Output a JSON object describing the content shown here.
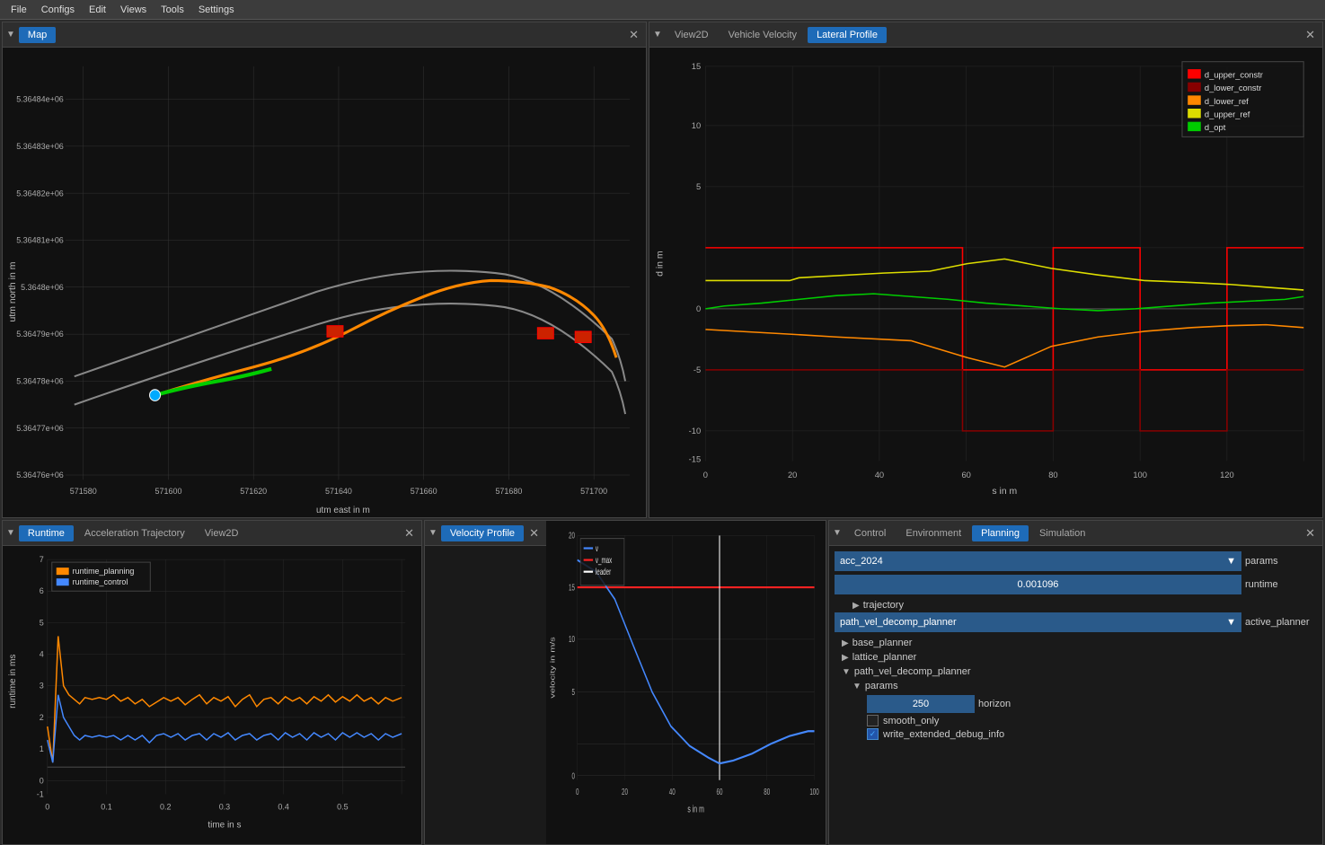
{
  "menubar": {
    "items": [
      "File",
      "Configs",
      "Edit",
      "Views",
      "Tools",
      "Settings"
    ]
  },
  "map_panel": {
    "title": "Map",
    "close_label": "✕",
    "x_axis_label": "utm east in m",
    "y_axis_label": "utm north in m",
    "x_ticks": [
      "571580",
      "571600",
      "571620",
      "571640",
      "571660",
      "571680",
      "571700"
    ],
    "y_ticks": [
      "5.36476e+06",
      "5.36477e+06",
      "5.36478e+06",
      "5.36479e+06",
      "5.3648e+06",
      "5.36481e+06",
      "5.36482e+06",
      "5.36483e+06",
      "5.36484e+06"
    ]
  },
  "lateral_panel": {
    "tabs": [
      "View2D",
      "Vehicle Velocity",
      "Lateral Profile"
    ],
    "active_tab": "Lateral Profile",
    "close_label": "✕",
    "legend": [
      {
        "label": "d_upper_constr",
        "color": "#ff0000"
      },
      {
        "label": "d_lower_constr",
        "color": "#cc0000"
      },
      {
        "label": "d_lower_ref",
        "color": "#ff8800"
      },
      {
        "label": "d_upper_ref",
        "color": "#dddd00"
      },
      {
        "label": "d_opt",
        "color": "#00ff00"
      }
    ],
    "x_axis_label": "s in m",
    "y_axis_label": "d in m",
    "x_ticks": [
      "0",
      "20",
      "40",
      "60",
      "80",
      "100",
      "120"
    ],
    "y_ticks": [
      "-15",
      "-10",
      "-5",
      "0",
      "5",
      "10",
      "15"
    ]
  },
  "runtime_panel": {
    "tabs": [
      "Runtime",
      "Acceleration Trajectory",
      "View2D"
    ],
    "active_tab": "Runtime",
    "close_label": "✕",
    "legend": [
      {
        "label": "runtime_planning",
        "color": "#ff8800"
      },
      {
        "label": "runtime_control",
        "color": "#4488ff"
      }
    ],
    "x_axis_label": "time in s",
    "y_axis_label": "runtime in ms",
    "x_ticks": [
      "0",
      "0.1",
      "0.2",
      "0.3",
      "0.4",
      "0.5"
    ],
    "y_ticks": [
      "-1",
      "0",
      "1",
      "2",
      "3",
      "4",
      "5",
      "6",
      "7"
    ]
  },
  "velocity_panel": {
    "tabs": [
      "Velocity Profile"
    ],
    "active_tab": "Velocity Profile",
    "close_label": "✕",
    "legend": [
      {
        "label": "v",
        "color": "#4488ff"
      },
      {
        "label": "v_max",
        "color": "#ff2222"
      },
      {
        "label": "leader",
        "color": "#ffffff"
      }
    ],
    "x_axis_label": "s in m",
    "y_axis_label": "velocity in m/s",
    "x_ticks": [
      "0",
      "20",
      "40",
      "60",
      "80",
      "100"
    ],
    "y_ticks": [
      "0",
      "5",
      "10",
      "15",
      "20"
    ]
  },
  "control_panel": {
    "tabs": [
      "Control",
      "Environment",
      "Planning",
      "Simulation"
    ],
    "active_tab": "Planning",
    "close_label": "✕",
    "acc_value": "acc_2024",
    "acc_label": "params",
    "runtime_value": "0.001096",
    "runtime_label": "runtime",
    "trajectory_label": "trajectory",
    "active_planner_value": "path_vel_decomp_planner",
    "active_planner_label": "active_planner",
    "base_planner_label": "base_planner",
    "lattice_planner_label": "lattice_planner",
    "path_vel_decomp_planner_label": "path_vel_decomp_planner",
    "params_label": "params",
    "horizon_value": "250",
    "horizon_label": "horizon",
    "smooth_only_label": "smooth_only",
    "write_debug_label": "write_extended_debug_info"
  }
}
